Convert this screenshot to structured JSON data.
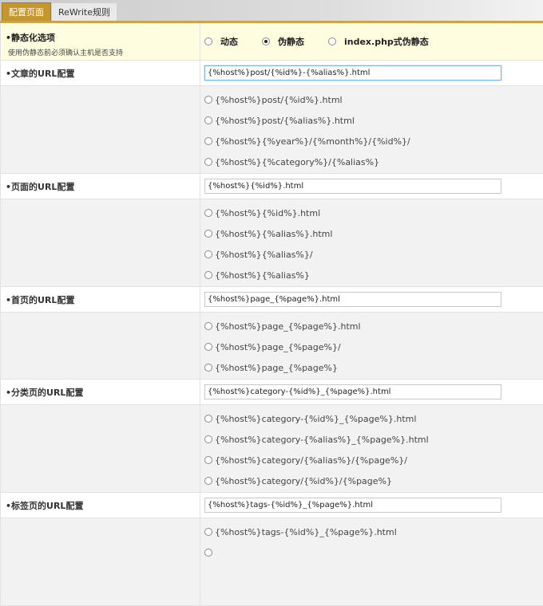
{
  "tabs": {
    "config": "配置页面",
    "rewrite": "ReWrite规则"
  },
  "static_option": {
    "title": "•静态化选项",
    "subtitle": "使用伪静态前必须确认主机是否支持",
    "modes": [
      "动态",
      "伪静态",
      "index.php式伪静态"
    ],
    "selected": "伪静态"
  },
  "article": {
    "label": "•文章的URL配置",
    "value": "{%host%}post/{%id%}-{%alias%}.html",
    "options": [
      "{%host%}post/{%id%}.html",
      "{%host%}post/{%alias%}.html",
      "{%host%}{%year%}/{%month%}/{%id%}/",
      "{%host%}{%category%}/{%alias%}"
    ]
  },
  "page": {
    "label": "•页面的URL配置",
    "value": "{%host%}{%id%}.html",
    "options": [
      "{%host%}{%id%}.html",
      "{%host%}{%alias%}.html",
      "{%host%}{%alias%}/",
      "{%host%}{%alias%}"
    ]
  },
  "home": {
    "label": "•首页的URL配置",
    "value": "{%host%}page_{%page%}.html",
    "options": [
      "{%host%}page_{%page%}.html",
      "{%host%}page_{%page%}/",
      "{%host%}page_{%page%}"
    ]
  },
  "category": {
    "label": "•分类页的URL配置",
    "value": "{%host%}category-{%id%}_{%page%}.html",
    "options": [
      "{%host%}category-{%id%}_{%page%}.html",
      "{%host%}category-{%alias%}_{%page%}.html",
      "{%host%}category/{%alias%}/{%page%}/",
      "{%host%}category/{%id%}/{%page%}"
    ]
  },
  "tags": {
    "label": "•标签页的URL配置",
    "value": "{%host%}tags-{%id%}_{%page%}.html",
    "options": [
      "{%host%}tags-{%id%}_{%page%}.html"
    ]
  }
}
